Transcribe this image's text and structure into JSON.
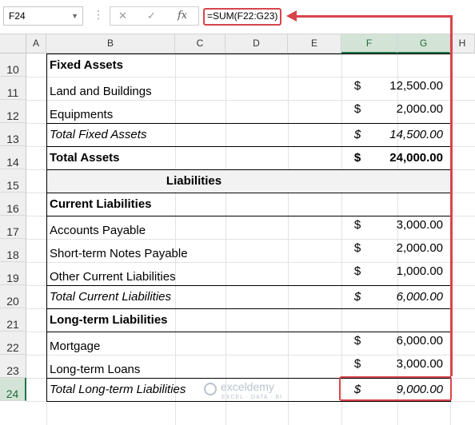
{
  "formula_bar": {
    "name_box": "F24",
    "formula": "=SUM(F22:G23)"
  },
  "columns": [
    "A",
    "B",
    "C",
    "D",
    "E",
    "F",
    "G",
    "H"
  ],
  "active_column_labels": [
    "F",
    "G"
  ],
  "rows": [
    {
      "num": "10",
      "label": "Fixed Assets",
      "dollar": "",
      "amount": "",
      "style": "bold"
    },
    {
      "num": "11",
      "label": "Land and Buildings",
      "dollar": "$",
      "amount": "12,500.00",
      "style": ""
    },
    {
      "num": "12",
      "label": "Equipments",
      "dollar": "$",
      "amount": "2,000.00",
      "style": ""
    },
    {
      "num": "13",
      "label": "Total Fixed Assets",
      "dollar": "$",
      "amount": "14,500.00",
      "style": "italic"
    },
    {
      "num": "14",
      "label": "Total Assets",
      "dollar": "$",
      "amount": "24,000.00",
      "style": "bold"
    },
    {
      "num": "15",
      "label": "Liabilities",
      "dollar": "",
      "amount": "",
      "style": "bold-center"
    },
    {
      "num": "16",
      "label": "Current Liabilities",
      "dollar": "",
      "amount": "",
      "style": "bold"
    },
    {
      "num": "17",
      "label": "Accounts Payable",
      "dollar": "$",
      "amount": "3,000.00",
      "style": ""
    },
    {
      "num": "18",
      "label": "Short-term Notes Payable",
      "dollar": "$",
      "amount": "2,000.00",
      "style": ""
    },
    {
      "num": "19",
      "label": "Other Current Liabilities",
      "dollar": "$",
      "amount": "1,000.00",
      "style": ""
    },
    {
      "num": "20",
      "label": "Total Current Liabilities",
      "dollar": "$",
      "amount": "6,000.00",
      "style": "italic"
    },
    {
      "num": "21",
      "label": "Long-term Liabilities",
      "dollar": "",
      "amount": "",
      "style": "bold"
    },
    {
      "num": "22",
      "label": "Mortgage",
      "dollar": "$",
      "amount": "6,000.00",
      "style": ""
    },
    {
      "num": "23",
      "label": "Long-term Loans",
      "dollar": "$",
      "amount": "3,000.00",
      "style": ""
    },
    {
      "num": "24",
      "label": "Total Long-term Liabilities",
      "dollar": "$",
      "amount": "9,000.00",
      "style": "italic"
    }
  ],
  "active_row": "24",
  "watermark": {
    "name": "exceldemy",
    "tagline": "EXCEL · DATA · BI"
  },
  "colors": {
    "highlight": "#d9444c",
    "excel_green": "#217346"
  }
}
